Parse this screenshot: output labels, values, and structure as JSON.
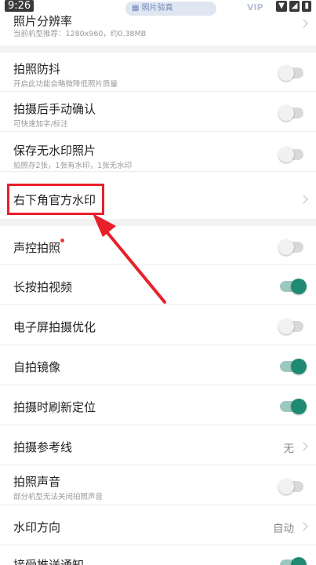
{
  "status_bar": {
    "time": "9:26",
    "center_pill": "照片验真",
    "vip": "VIP",
    "icons": [
      "wifi-icon",
      "signal-icon",
      "battery-icon"
    ]
  },
  "rows": {
    "resolution": {
      "title": "照片分辨率",
      "subtitle": "当前机型推荐：1280x960，约0.38MB"
    },
    "stabilize": {
      "title": "拍照防抖",
      "subtitle": "开启此功能会略微降低照片质量",
      "on": false
    },
    "manual_confirm": {
      "title": "拍摄后手动确认",
      "subtitle": "可快速加字/标注",
      "on": false
    },
    "save_no_watermark": {
      "title": "保存无水印照片",
      "subtitle": "拍照存2张，1张有水印，1张无水印",
      "on": false
    },
    "official_watermark": {
      "title": "右下角官方水印"
    },
    "voice_capture": {
      "title": "声控拍照",
      "on": false
    },
    "long_press_video": {
      "title": "长按拍视频",
      "on": true
    },
    "screen_optimize": {
      "title": "电子屏拍摄优化",
      "on": false
    },
    "selfie_mirror": {
      "title": "自拍镜像",
      "on": true
    },
    "refresh_location": {
      "title": "拍摄时刷新定位",
      "on": true
    },
    "guide_lines": {
      "title": "拍摄参考线",
      "value": "无"
    },
    "shutter_sound": {
      "title": "拍照声音",
      "subtitle": "部分机型无法关闭拍照声音",
      "on": false
    },
    "watermark_direction": {
      "title": "水印方向",
      "value": "自动"
    },
    "push_notify": {
      "title": "接受推送通知",
      "on": true
    }
  },
  "colors": {
    "toggle_on": "#1e8a72",
    "highlight": "#e8202a"
  }
}
